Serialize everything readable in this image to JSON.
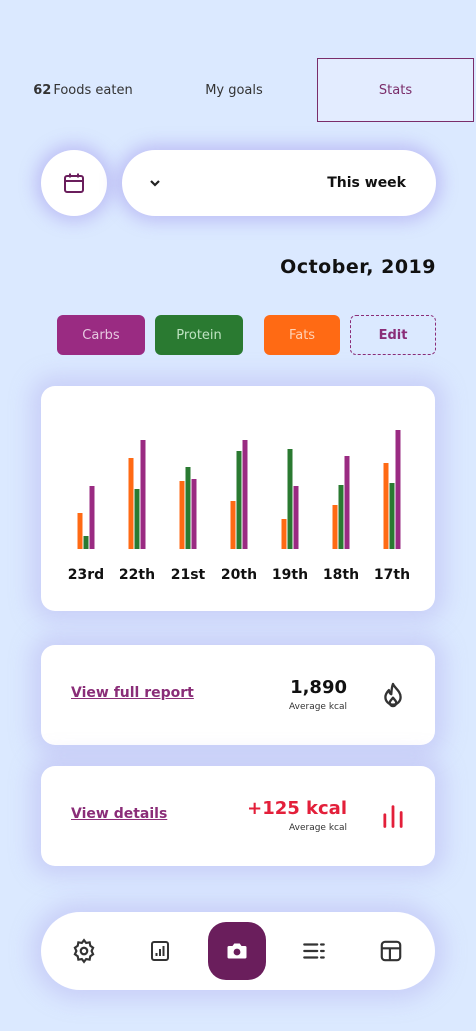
{
  "tabs": {
    "food": "Foods eaten",
    "food_count": "62",
    "goals": "My goals",
    "stats": "Stats"
  },
  "week": {
    "label": "This week"
  },
  "month": "October, 2019",
  "filters": {
    "carbs": "Carbs",
    "protein": "Protein",
    "fats": "Fats",
    "edit": "Edit"
  },
  "colors": {
    "fats": "#ff6a14",
    "protein": "#2a7a31",
    "carbs": "#9a2b82",
    "accent": "#6a1e5c",
    "red": "#e31f3a"
  },
  "chart_data": {
    "type": "bar",
    "categories": [
      "23rd",
      "22th",
      "21st",
      "20th",
      "19th",
      "18th",
      "17th"
    ],
    "series": [
      {
        "name": "Fats",
        "values": [
          36,
          91,
          68,
          48,
          30,
          44,
          86
        ]
      },
      {
        "name": "Protein",
        "values": [
          13,
          60,
          82,
          98,
          100,
          64,
          66
        ]
      },
      {
        "name": "Carbs",
        "values": [
          63,
          109,
          70,
          109,
          63,
          93,
          119
        ]
      }
    ],
    "ylim": [
      0,
      130
    ],
    "grid": false,
    "legend": "none"
  },
  "kcal_card": {
    "value": "1,890",
    "caption": "Average kcal",
    "link": "View full report"
  },
  "diff_card": {
    "value": "+125 kcal",
    "caption": "Average kcal",
    "link": "View details"
  }
}
